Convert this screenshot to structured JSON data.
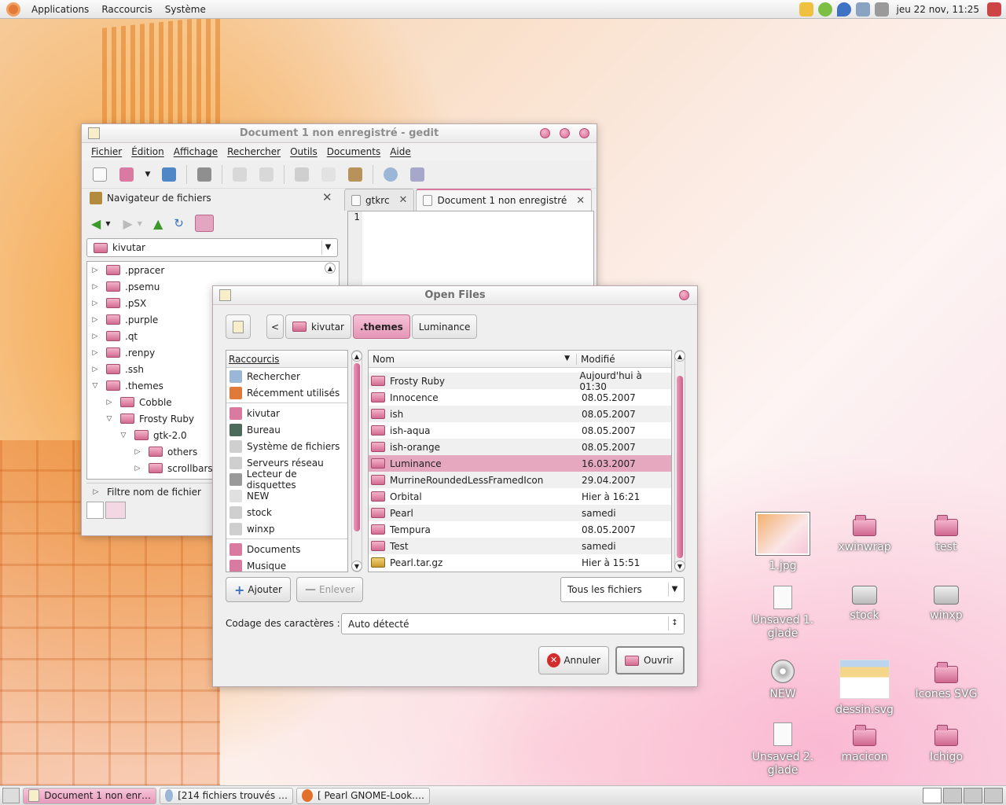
{
  "top_panel": {
    "menus": [
      "Applications",
      "Raccourcis",
      "Système"
    ],
    "clock": "jeu 22 nov, 11:25"
  },
  "gedit": {
    "title": "Document 1 non enregistré - gedit",
    "menus": [
      "Fichier",
      "Édition",
      "Affichage",
      "Rechercher",
      "Outils",
      "Documents",
      "Aide"
    ],
    "side_panel_title": "Navigateur de fichiers",
    "location": "kivutar",
    "tree": [
      {
        "label": ".ppracer",
        "depth": 0,
        "expanded": false
      },
      {
        "label": ".psemu",
        "depth": 0,
        "expanded": false
      },
      {
        "label": ".pSX",
        "depth": 0,
        "expanded": false
      },
      {
        "label": ".purple",
        "depth": 0,
        "expanded": false
      },
      {
        "label": ".qt",
        "depth": 0,
        "expanded": false
      },
      {
        "label": ".renpy",
        "depth": 0,
        "expanded": false
      },
      {
        "label": ".ssh",
        "depth": 0,
        "expanded": false
      },
      {
        "label": ".themes",
        "depth": 0,
        "expanded": true
      },
      {
        "label": "Cobble",
        "depth": 1,
        "expanded": false
      },
      {
        "label": "Frosty Ruby",
        "depth": 1,
        "expanded": true
      },
      {
        "label": "gtk-2.0",
        "depth": 2,
        "expanded": true
      },
      {
        "label": "others",
        "depth": 3,
        "expanded": false
      },
      {
        "label": "scrollbars",
        "depth": 3,
        "expanded": false
      }
    ],
    "filter_label": "Filtre nom de fichier",
    "tabs": [
      {
        "label": "gtkrc"
      },
      {
        "label": "Document 1 non enregistré"
      }
    ],
    "line_number": "1"
  },
  "dialog": {
    "title": "Open Files",
    "path": [
      "kivutar",
      ".themes",
      "Luminance"
    ],
    "back_label": "<",
    "shortcuts_header": "Raccourcis",
    "shortcuts_group1": [
      "Rechercher",
      "Récemment utilisés"
    ],
    "shortcuts_group2": [
      "kivutar",
      "Bureau",
      "Système de fichiers",
      "Serveurs réseau",
      "Lecteur de disquettes",
      "NEW",
      "stock",
      "winxp"
    ],
    "shortcuts_group3": [
      "Documents",
      "Musique"
    ],
    "col_name": "Nom",
    "col_modified": "Modifié",
    "files": [
      {
        "name": "Frosty Ruby",
        "modified": "Aujourd'hui à 01:30",
        "kind": "folder"
      },
      {
        "name": "Innocence",
        "modified": "08.05.2007",
        "kind": "folder"
      },
      {
        "name": "ish",
        "modified": "08.05.2007",
        "kind": "folder"
      },
      {
        "name": "ish-aqua",
        "modified": "08.05.2007",
        "kind": "folder"
      },
      {
        "name": "ish-orange",
        "modified": "08.05.2007",
        "kind": "folder"
      },
      {
        "name": "Luminance",
        "modified": "16.03.2007",
        "kind": "folder"
      },
      {
        "name": "MurrineRoundedLessFramedIcon",
        "modified": "29.04.2007",
        "kind": "folder"
      },
      {
        "name": "Orbital",
        "modified": "Hier à 16:21",
        "kind": "folder"
      },
      {
        "name": "Pearl",
        "modified": "samedi",
        "kind": "folder"
      },
      {
        "name": "Tempura",
        "modified": "08.05.2007",
        "kind": "folder"
      },
      {
        "name": "Test",
        "modified": "samedi",
        "kind": "folder"
      },
      {
        "name": "Pearl.tar.gz",
        "modified": "Hier à 15:51",
        "kind": "archive"
      }
    ],
    "selected_file": "Luminance",
    "add_label": "Ajouter",
    "remove_label": "Enlever",
    "filter_value": "Tous les fichiers",
    "encoding_label": "Codage des caractères :",
    "encoding_value": "Auto détecté",
    "cancel_label": "Annuler",
    "open_label": "Ouvrir"
  },
  "desktop_icons": [
    {
      "label": "1.jpg",
      "kind": "image"
    },
    {
      "label": "xwinwrap",
      "kind": "folder"
    },
    {
      "label": "test",
      "kind": "folder"
    },
    {
      "label": "Unsaved 1. glade",
      "kind": "doc"
    },
    {
      "label": "stock",
      "kind": "drive"
    },
    {
      "label": "winxp",
      "kind": "drive"
    },
    {
      "label": "NEW",
      "kind": "cd"
    },
    {
      "label": "dessin.svg",
      "kind": "svg"
    },
    {
      "label": "Icones SVG",
      "kind": "folder"
    },
    {
      "label": "Unsaved 2. glade",
      "kind": "doc"
    },
    {
      "label": "macicon",
      "kind": "folder"
    },
    {
      "label": "Ichigo",
      "kind": "folder"
    }
  ],
  "taskbar": [
    {
      "label": "Document 1 non enr…",
      "active": true
    },
    {
      "label": "[214 fichiers trouvés …",
      "active": false
    },
    {
      "label": "[ Pearl GNOME-Look.…",
      "active": false
    }
  ]
}
